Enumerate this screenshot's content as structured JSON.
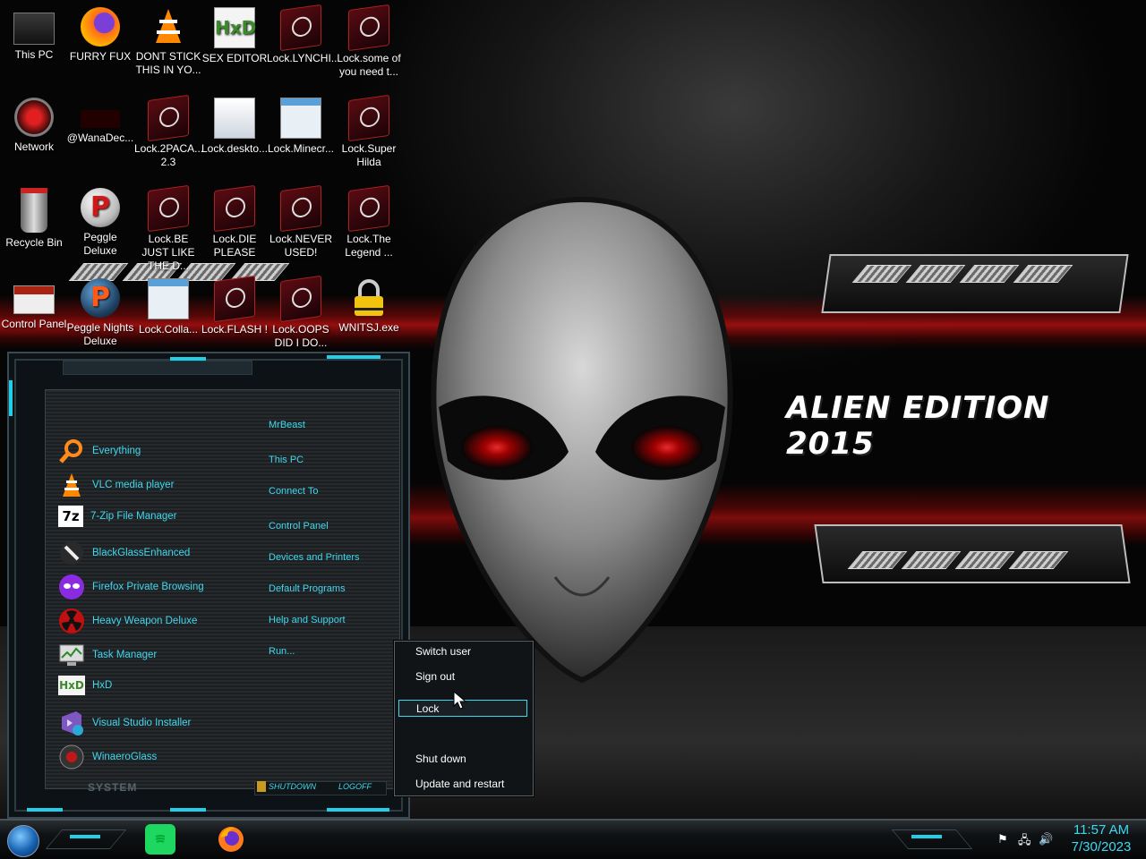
{
  "desktop": {
    "icons": [
      {
        "label": "This PC",
        "icon": "this-pc-icon"
      },
      {
        "label": "FURRY FUX",
        "icon": "firefox-icon"
      },
      {
        "label": "DONT STICK THIS IN YO...",
        "icon": "vlc-icon"
      },
      {
        "label": "SEX EDITOR",
        "icon": "hxd-icon"
      },
      {
        "label": "Lock.LYNCHI...",
        "icon": "lock-file-icon"
      },
      {
        "label": "Lock.some of you need t...",
        "icon": "lock-file-icon"
      },
      {
        "label": "Network",
        "icon": "network-icon"
      },
      {
        "label": "@WanaDec...",
        "icon": "wanadecrypt-icon"
      },
      {
        "label": "Lock.2PACA... 2.3",
        "icon": "lock-file-icon"
      },
      {
        "label": "Lock.deskto...",
        "icon": "settings-file-icon"
      },
      {
        "label": "Lock.Minecr...",
        "icon": "window-file-icon"
      },
      {
        "label": "Lock.Super Hilda",
        "icon": "lock-file-icon"
      },
      {
        "label": "Recycle Bin",
        "icon": "recycle-bin-icon"
      },
      {
        "label": "Peggle Deluxe",
        "icon": "peggle-icon"
      },
      {
        "label": "Lock.BE JUST LIKE THE D...",
        "icon": "lock-file-icon"
      },
      {
        "label": "Lock.DIE PLEASE",
        "icon": "lock-file-icon"
      },
      {
        "label": "Lock.NEVER USED!",
        "icon": "lock-file-icon"
      },
      {
        "label": "Lock.The Legend ...",
        "icon": "lock-file-icon"
      },
      {
        "label": "Control Panel",
        "icon": "control-panel-icon"
      },
      {
        "label": "Peggle Nights Deluxe",
        "icon": "peggle-nights-icon"
      },
      {
        "label": "Lock.Colla...",
        "icon": "window-file-icon"
      },
      {
        "label": "Lock.FLASH !",
        "icon": "lock-file-icon"
      },
      {
        "label": "Lock.OOPS DID I DO...",
        "icon": "lock-file-icon"
      },
      {
        "label": "WNITSJ.exe",
        "icon": "padlock-icon"
      }
    ],
    "wallpaper_title": "ALIEN EDITION 2015"
  },
  "start_menu": {
    "programs": [
      {
        "label": "Everything",
        "icon": "magnifier-icon"
      },
      {
        "label": "VLC media player",
        "icon": "vlc-icon"
      },
      {
        "label": "7-Zip File Manager",
        "icon": "7zip-icon"
      },
      {
        "label": "BlackGlassEnhanced",
        "icon": "brush-icon"
      },
      {
        "label": "Firefox Private Browsing",
        "icon": "private-browsing-icon"
      },
      {
        "label": "Heavy Weapon Deluxe",
        "icon": "radiation-icon"
      },
      {
        "label": "Task Manager",
        "icon": "task-manager-icon"
      },
      {
        "label": "HxD",
        "icon": "hxd-icon"
      },
      {
        "label": "Visual Studio Installer",
        "icon": "visual-studio-icon"
      },
      {
        "label": "WinaeroGlass",
        "icon": "winaero-icon"
      }
    ],
    "places": [
      "MrBeast",
      "This PC",
      "Connect To",
      "Control Panel",
      "Devices and Printers",
      "Default Programs",
      "Help and Support",
      "Run..."
    ],
    "shutdown_label": "SHUTDOWN",
    "logoff_label": "LOGOFF",
    "system_label": "SYSTEM"
  },
  "power_menu": {
    "items": [
      "Switch user",
      "Sign out",
      "Lock",
      "Shut down",
      "Update and restart"
    ],
    "selected": "Lock"
  },
  "taskbar": {
    "pinned": [
      "spotify-icon",
      "firefox-icon"
    ],
    "clock_time": "11:57 AM",
    "clock_date": "7/30/2023"
  },
  "colors": {
    "accent": "#3fd8ef",
    "wallpaper_red": "#b01010"
  }
}
